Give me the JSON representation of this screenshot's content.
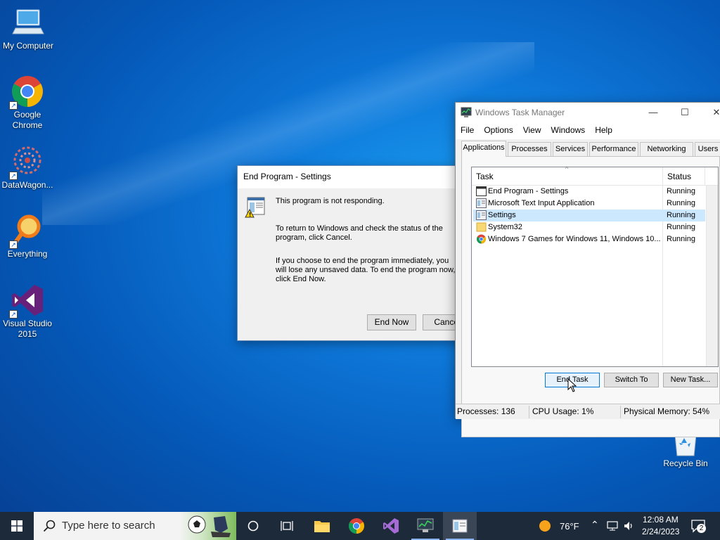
{
  "desktop": {
    "icons": [
      {
        "label": "My Computer",
        "icon": "computer-icon"
      },
      {
        "label": "Google Chrome",
        "icon": "chrome-icon"
      },
      {
        "label": "DataWagon...",
        "icon": "datawagon-icon"
      },
      {
        "label": "Everything",
        "icon": "everything-search-icon"
      },
      {
        "label": "Visual Studio 2015",
        "icon": "visual-studio-icon"
      },
      {
        "label": "Recycle Bin",
        "icon": "recycle-bin-icon"
      }
    ]
  },
  "end_program_dialog": {
    "title": "End Program - Settings",
    "line1": "This program is not responding.",
    "line2": "To return to Windows and check the status of the program, click Cancel.",
    "line3": "If you choose to end the program immediately, you will lose any unsaved data. To end the program now, click End Now.",
    "end_now_label": "End Now",
    "cancel_label": "Cancel"
  },
  "task_manager": {
    "title": "Windows Task Manager",
    "menu": [
      "File",
      "Options",
      "View",
      "Windows",
      "Help"
    ],
    "tabs": [
      "Applications",
      "Processes",
      "Services",
      "Performance",
      "Networking",
      "Users"
    ],
    "active_tab": "Applications",
    "columns": {
      "task": "Task",
      "status": "Status"
    },
    "rows": [
      {
        "task": "End Program - Settings",
        "status": "Running",
        "icon": "window-icon"
      },
      {
        "task": "Microsoft Text Input Application",
        "status": "Running",
        "icon": "app-icon"
      },
      {
        "task": "Settings",
        "status": "Running",
        "icon": "app-icon",
        "selected": true
      },
      {
        "task": "System32",
        "status": "Running",
        "icon": "folder-icon"
      },
      {
        "task": "Windows 7 Games for Windows 11, Windows 10...",
        "status": "Running",
        "icon": "chrome-icon"
      }
    ],
    "buttons": {
      "end_task": "End Task",
      "switch_to": "Switch To",
      "new_task": "New Task..."
    },
    "status_bar": {
      "processes": "Processes: 136",
      "cpu": "CPU Usage: 1%",
      "memory": "Physical Memory: 54%"
    }
  },
  "taskbar": {
    "search_placeholder": "Type here to search",
    "weather": "76°F",
    "time": "12:08 AM",
    "date": "2/24/2023",
    "notification_count": "2"
  }
}
